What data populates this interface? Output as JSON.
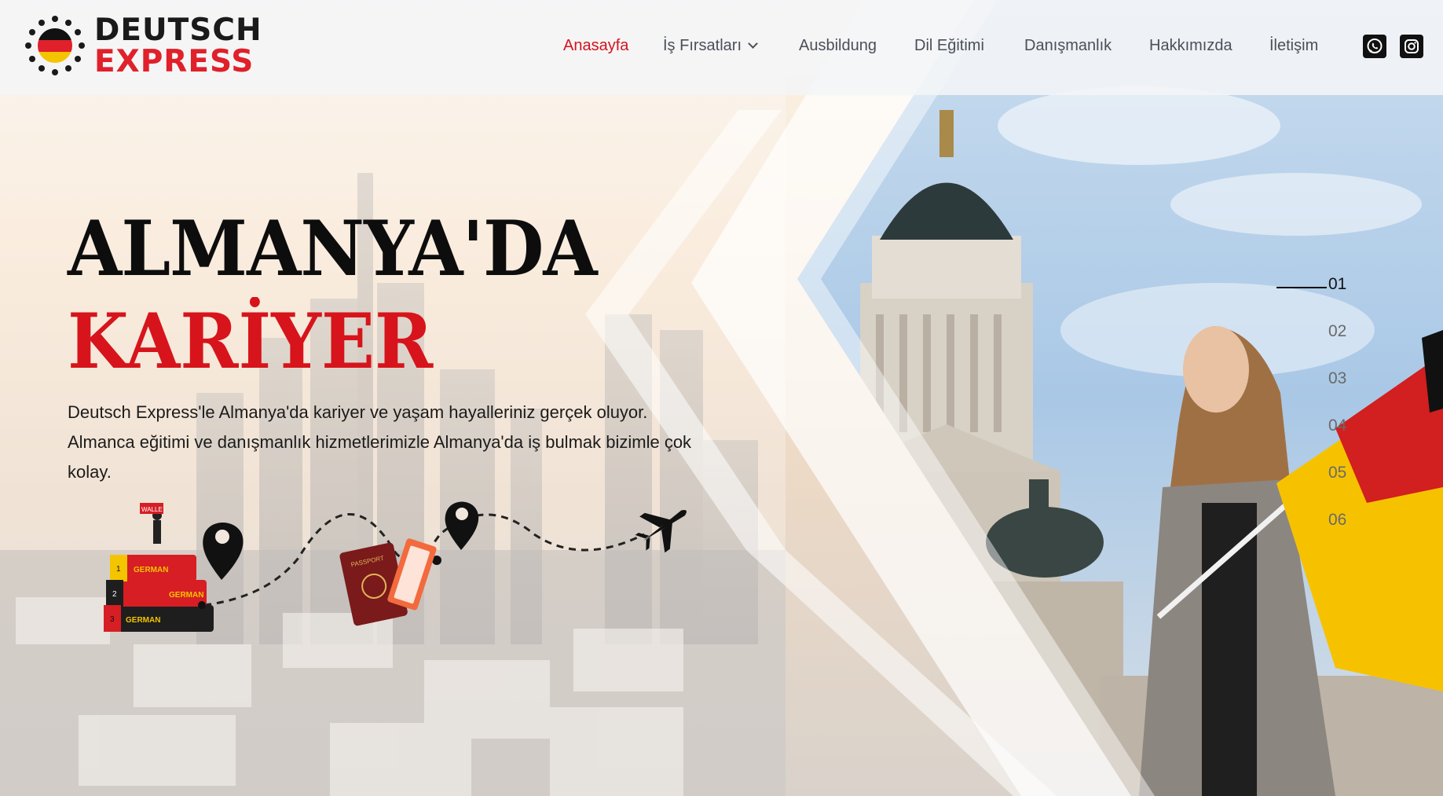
{
  "brand": {
    "word1": "DEUTSCH",
    "word2": "EXPRESS",
    "colors": {
      "black": "#1a1a1a",
      "red": "#e0202a",
      "gold": "#f5c400"
    }
  },
  "nav": {
    "items": [
      {
        "label": "Anasayfa",
        "active": true
      },
      {
        "label": "İş Fırsatları",
        "has_dropdown": true
      },
      {
        "label": "Ausbildung"
      },
      {
        "label": "Dil Eğitimi"
      },
      {
        "label": "Danışmanlık"
      },
      {
        "label": "Hakkımızda"
      },
      {
        "label": "İletişim"
      }
    ],
    "active_color": "#d4141d",
    "text_color": "#4b4f58"
  },
  "social": [
    {
      "icon": "whatsapp-icon"
    },
    {
      "icon": "instagram-icon"
    }
  ],
  "hero": {
    "title_line1": "ALMANYA'DA",
    "title_line2": "KARİYER",
    "description": "Deutsch Express'le Almanya'da kariyer ve yaşam hayalleriniz gerçek oluyor. Almanca eğitimi ve danışmanlık hizmetlerimizle Almanya'da iş bulmak bizimle çok kolay.",
    "accent_color": "#d7141b"
  },
  "illustration": {
    "book_labels": [
      "GERMAN",
      "GERMAN",
      "GERMAN"
    ],
    "book_numbers": [
      "1",
      "2",
      "3"
    ],
    "sign_text": "WALLE",
    "passport_text": "PASSPORT",
    "icons": [
      "books-icon",
      "map-pin-icon",
      "passport-icon",
      "tickets-icon",
      "airplane-icon"
    ]
  },
  "slider": {
    "items": [
      "01",
      "02",
      "03",
      "04",
      "05",
      "06"
    ],
    "active_index": 0
  }
}
